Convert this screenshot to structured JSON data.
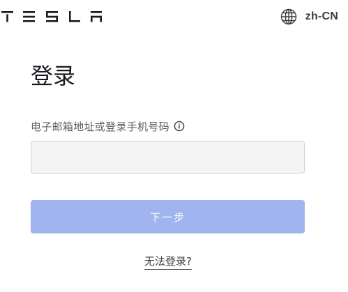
{
  "header": {
    "logo_text": "TESLA",
    "language_label": "zh-CN",
    "language_icon": "globe-icon"
  },
  "form": {
    "title": "登录",
    "email_label": "电子邮箱地址或登录手机号码",
    "info_icon": "info-icon",
    "email_value": "",
    "email_placeholder": "",
    "next_label": "下一步",
    "cant_login_label": "无法登录?"
  },
  "colors": {
    "primary_disabled": "#a0b4ef",
    "text_primary": "#171a20",
    "text_secondary": "#5c5e62",
    "input_background": "#f4f4f4"
  }
}
